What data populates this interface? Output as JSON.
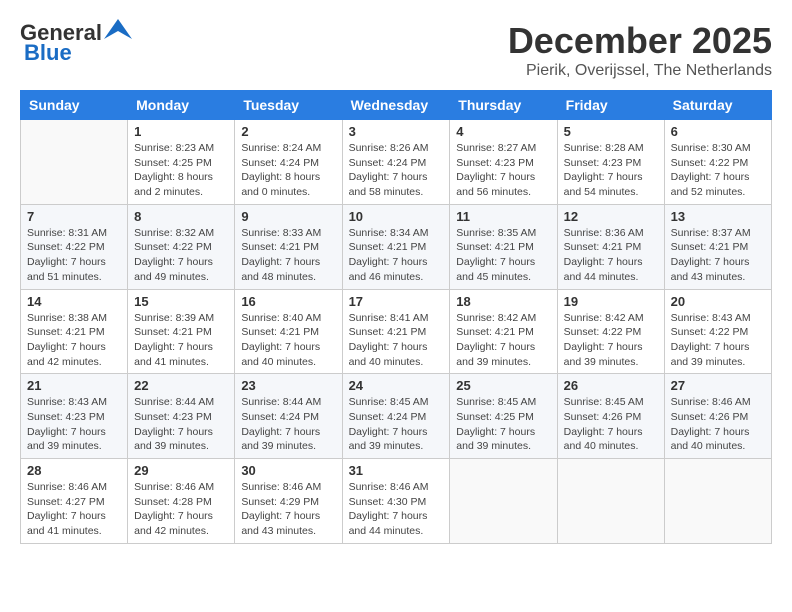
{
  "logo": {
    "line1": "General",
    "line2": "Blue"
  },
  "title": "December 2025",
  "subtitle": "Pierik, Overijssel, The Netherlands",
  "days_of_week": [
    "Sunday",
    "Monday",
    "Tuesday",
    "Wednesday",
    "Thursday",
    "Friday",
    "Saturday"
  ],
  "weeks": [
    [
      {
        "day": "",
        "sunrise": "",
        "sunset": "",
        "daylight": ""
      },
      {
        "day": "1",
        "sunrise": "Sunrise: 8:23 AM",
        "sunset": "Sunset: 4:25 PM",
        "daylight": "Daylight: 8 hours and 2 minutes."
      },
      {
        "day": "2",
        "sunrise": "Sunrise: 8:24 AM",
        "sunset": "Sunset: 4:24 PM",
        "daylight": "Daylight: 8 hours and 0 minutes."
      },
      {
        "day": "3",
        "sunrise": "Sunrise: 8:26 AM",
        "sunset": "Sunset: 4:24 PM",
        "daylight": "Daylight: 7 hours and 58 minutes."
      },
      {
        "day": "4",
        "sunrise": "Sunrise: 8:27 AM",
        "sunset": "Sunset: 4:23 PM",
        "daylight": "Daylight: 7 hours and 56 minutes."
      },
      {
        "day": "5",
        "sunrise": "Sunrise: 8:28 AM",
        "sunset": "Sunset: 4:23 PM",
        "daylight": "Daylight: 7 hours and 54 minutes."
      },
      {
        "day": "6",
        "sunrise": "Sunrise: 8:30 AM",
        "sunset": "Sunset: 4:22 PM",
        "daylight": "Daylight: 7 hours and 52 minutes."
      }
    ],
    [
      {
        "day": "7",
        "sunrise": "Sunrise: 8:31 AM",
        "sunset": "Sunset: 4:22 PM",
        "daylight": "Daylight: 7 hours and 51 minutes."
      },
      {
        "day": "8",
        "sunrise": "Sunrise: 8:32 AM",
        "sunset": "Sunset: 4:22 PM",
        "daylight": "Daylight: 7 hours and 49 minutes."
      },
      {
        "day": "9",
        "sunrise": "Sunrise: 8:33 AM",
        "sunset": "Sunset: 4:21 PM",
        "daylight": "Daylight: 7 hours and 48 minutes."
      },
      {
        "day": "10",
        "sunrise": "Sunrise: 8:34 AM",
        "sunset": "Sunset: 4:21 PM",
        "daylight": "Daylight: 7 hours and 46 minutes."
      },
      {
        "day": "11",
        "sunrise": "Sunrise: 8:35 AM",
        "sunset": "Sunset: 4:21 PM",
        "daylight": "Daylight: 7 hours and 45 minutes."
      },
      {
        "day": "12",
        "sunrise": "Sunrise: 8:36 AM",
        "sunset": "Sunset: 4:21 PM",
        "daylight": "Daylight: 7 hours and 44 minutes."
      },
      {
        "day": "13",
        "sunrise": "Sunrise: 8:37 AM",
        "sunset": "Sunset: 4:21 PM",
        "daylight": "Daylight: 7 hours and 43 minutes."
      }
    ],
    [
      {
        "day": "14",
        "sunrise": "Sunrise: 8:38 AM",
        "sunset": "Sunset: 4:21 PM",
        "daylight": "Daylight: 7 hours and 42 minutes."
      },
      {
        "day": "15",
        "sunrise": "Sunrise: 8:39 AM",
        "sunset": "Sunset: 4:21 PM",
        "daylight": "Daylight: 7 hours and 41 minutes."
      },
      {
        "day": "16",
        "sunrise": "Sunrise: 8:40 AM",
        "sunset": "Sunset: 4:21 PM",
        "daylight": "Daylight: 7 hours and 40 minutes."
      },
      {
        "day": "17",
        "sunrise": "Sunrise: 8:41 AM",
        "sunset": "Sunset: 4:21 PM",
        "daylight": "Daylight: 7 hours and 40 minutes."
      },
      {
        "day": "18",
        "sunrise": "Sunrise: 8:42 AM",
        "sunset": "Sunset: 4:21 PM",
        "daylight": "Daylight: 7 hours and 39 minutes."
      },
      {
        "day": "19",
        "sunrise": "Sunrise: 8:42 AM",
        "sunset": "Sunset: 4:22 PM",
        "daylight": "Daylight: 7 hours and 39 minutes."
      },
      {
        "day": "20",
        "sunrise": "Sunrise: 8:43 AM",
        "sunset": "Sunset: 4:22 PM",
        "daylight": "Daylight: 7 hours and 39 minutes."
      }
    ],
    [
      {
        "day": "21",
        "sunrise": "Sunrise: 8:43 AM",
        "sunset": "Sunset: 4:23 PM",
        "daylight": "Daylight: 7 hours and 39 minutes."
      },
      {
        "day": "22",
        "sunrise": "Sunrise: 8:44 AM",
        "sunset": "Sunset: 4:23 PM",
        "daylight": "Daylight: 7 hours and 39 minutes."
      },
      {
        "day": "23",
        "sunrise": "Sunrise: 8:44 AM",
        "sunset": "Sunset: 4:24 PM",
        "daylight": "Daylight: 7 hours and 39 minutes."
      },
      {
        "day": "24",
        "sunrise": "Sunrise: 8:45 AM",
        "sunset": "Sunset: 4:24 PM",
        "daylight": "Daylight: 7 hours and 39 minutes."
      },
      {
        "day": "25",
        "sunrise": "Sunrise: 8:45 AM",
        "sunset": "Sunset: 4:25 PM",
        "daylight": "Daylight: 7 hours and 39 minutes."
      },
      {
        "day": "26",
        "sunrise": "Sunrise: 8:45 AM",
        "sunset": "Sunset: 4:26 PM",
        "daylight": "Daylight: 7 hours and 40 minutes."
      },
      {
        "day": "27",
        "sunrise": "Sunrise: 8:46 AM",
        "sunset": "Sunset: 4:26 PM",
        "daylight": "Daylight: 7 hours and 40 minutes."
      }
    ],
    [
      {
        "day": "28",
        "sunrise": "Sunrise: 8:46 AM",
        "sunset": "Sunset: 4:27 PM",
        "daylight": "Daylight: 7 hours and 41 minutes."
      },
      {
        "day": "29",
        "sunrise": "Sunrise: 8:46 AM",
        "sunset": "Sunset: 4:28 PM",
        "daylight": "Daylight: 7 hours and 42 minutes."
      },
      {
        "day": "30",
        "sunrise": "Sunrise: 8:46 AM",
        "sunset": "Sunset: 4:29 PM",
        "daylight": "Daylight: 7 hours and 43 minutes."
      },
      {
        "day": "31",
        "sunrise": "Sunrise: 8:46 AM",
        "sunset": "Sunset: 4:30 PM",
        "daylight": "Daylight: 7 hours and 44 minutes."
      },
      {
        "day": "",
        "sunrise": "",
        "sunset": "",
        "daylight": ""
      },
      {
        "day": "",
        "sunrise": "",
        "sunset": "",
        "daylight": ""
      },
      {
        "day": "",
        "sunrise": "",
        "sunset": "",
        "daylight": ""
      }
    ]
  ]
}
